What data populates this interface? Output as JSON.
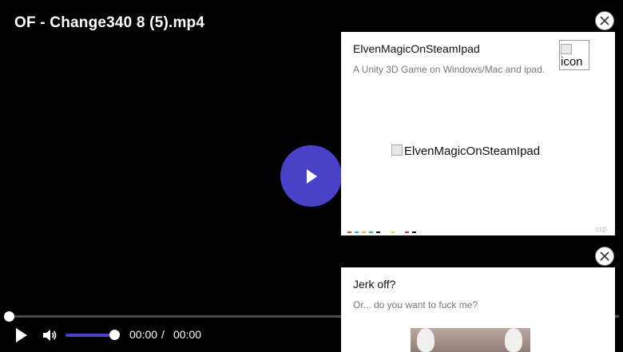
{
  "player": {
    "title": "OF - Change340 8 (5).mp4",
    "current_time": "00:00",
    "separator": "/",
    "duration": "00:00",
    "progress": 0,
    "volume": 1,
    "accent_color": "#4a41c9"
  },
  "ads": [
    {
      "title": "ElvenMagicOnSteamIpad",
      "description": "A Unity 3D Game on Windows/Mac and ipad.",
      "icon_alt": "icon",
      "image_alt": "ElvenMagicOnSteamIpad",
      "footer": "ccp"
    },
    {
      "title": "Jerk off?",
      "description": "Or... do you want to fuck me?"
    }
  ]
}
